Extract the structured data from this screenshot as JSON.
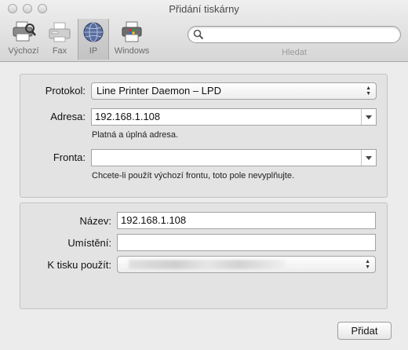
{
  "window": {
    "title": "Přidání tiskárny"
  },
  "toolbar": {
    "items": [
      {
        "label": "Výchozí",
        "icon": "printer-search-icon"
      },
      {
        "label": "Fax",
        "icon": "fax-icon"
      },
      {
        "label": "IP",
        "icon": "globe-icon",
        "selected": true
      },
      {
        "label": "Windows",
        "icon": "windows-printer-icon"
      }
    ],
    "search": {
      "placeholder": "",
      "label": "Hledat"
    }
  },
  "connection": {
    "protocol_label": "Protokol:",
    "protocol_value": "Line Printer Daemon – LPD",
    "address_label": "Adresa:",
    "address_value": "192.168.1.108",
    "address_hint": "Platná a úplná adresa.",
    "queue_label": "Fronta:",
    "queue_value": "",
    "queue_hint": "Chcete-li použít výchozí frontu, toto pole nevyplňujte."
  },
  "details": {
    "name_label": "Název:",
    "name_value": "192.168.1.108",
    "location_label": "Umístění:",
    "location_value": "",
    "use_label": "K tisku použít:"
  },
  "actions": {
    "add_label": "Přidat"
  }
}
